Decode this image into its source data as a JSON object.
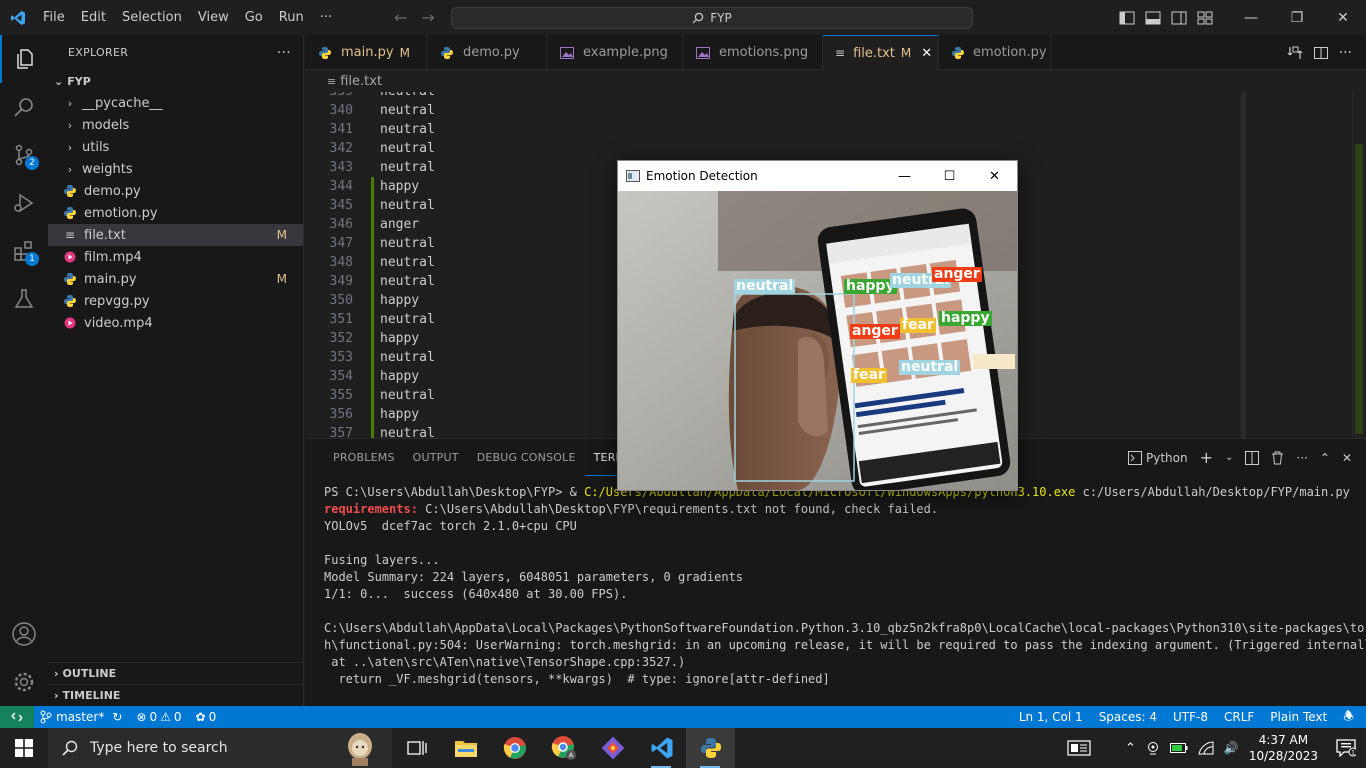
{
  "titlebar": {
    "menu": [
      "File",
      "Edit",
      "Selection",
      "View",
      "Go",
      "Run",
      "···"
    ],
    "search_text": "FYP"
  },
  "activity": {
    "source_control_badge": "2",
    "extensions_badge": "1"
  },
  "explorer": {
    "title": "EXPLORER",
    "more": "···",
    "folder": "FYP",
    "items": [
      {
        "label": "__pycache__",
        "type": "folder",
        "mark": ""
      },
      {
        "label": "models",
        "type": "folder",
        "mark": ""
      },
      {
        "label": "utils",
        "type": "folder",
        "mark": ""
      },
      {
        "label": "weights",
        "type": "folder",
        "mark": ""
      },
      {
        "label": "demo.py",
        "type": "py",
        "mark": ""
      },
      {
        "label": "emotion.py",
        "type": "py",
        "mark": ""
      },
      {
        "label": "file.txt",
        "type": "txt",
        "mark": "M"
      },
      {
        "label": "film.mp4",
        "type": "mp4",
        "mark": ""
      },
      {
        "label": "main.py",
        "type": "py",
        "mark": "M"
      },
      {
        "label": "repvgg.py",
        "type": "py",
        "mark": ""
      },
      {
        "label": "video.mp4",
        "type": "mp4",
        "mark": ""
      }
    ],
    "outline": "OUTLINE",
    "timeline": "TIMELINE"
  },
  "tabs": [
    {
      "label": "main.py",
      "type": "py",
      "mark": "M",
      "active": false
    },
    {
      "label": "demo.py",
      "type": "py",
      "mark": "",
      "active": false
    },
    {
      "label": "example.png",
      "type": "png",
      "mark": "",
      "active": false
    },
    {
      "label": "emotions.png",
      "type": "png",
      "mark": "",
      "active": false
    },
    {
      "label": "file.txt",
      "type": "txt",
      "mark": "M",
      "active": true
    },
    {
      "label": "emotion.py",
      "type": "py",
      "mark": "",
      "active": false
    }
  ],
  "breadcrumb": "file.txt",
  "editor": {
    "lines": [
      {
        "n": "339",
        "t": "neutral",
        "mod": false
      },
      {
        "n": "340",
        "t": "neutral",
        "mod": false
      },
      {
        "n": "341",
        "t": "neutral",
        "mod": false
      },
      {
        "n": "342",
        "t": "neutral",
        "mod": false
      },
      {
        "n": "343",
        "t": "neutral",
        "mod": false
      },
      {
        "n": "344",
        "t": "happy",
        "mod": true
      },
      {
        "n": "345",
        "t": "neutral",
        "mod": true
      },
      {
        "n": "346",
        "t": "anger",
        "mod": true
      },
      {
        "n": "347",
        "t": "neutral",
        "mod": true
      },
      {
        "n": "348",
        "t": "neutral",
        "mod": true
      },
      {
        "n": "349",
        "t": "neutral",
        "mod": true
      },
      {
        "n": "350",
        "t": "happy",
        "mod": true
      },
      {
        "n": "351",
        "t": "neutral",
        "mod": true
      },
      {
        "n": "352",
        "t": "happy",
        "mod": true
      },
      {
        "n": "353",
        "t": "neutral",
        "mod": true
      },
      {
        "n": "354",
        "t": "happy",
        "mod": true
      },
      {
        "n": "355",
        "t": "neutral",
        "mod": true
      },
      {
        "n": "356",
        "t": "happy",
        "mod": true
      },
      {
        "n": "357",
        "t": "neutral",
        "mod": true
      }
    ]
  },
  "panel": {
    "tabs": [
      "PROBLEMS",
      "OUTPUT",
      "DEBUG CONSOLE",
      "TERMINAL"
    ],
    "shell": "Python",
    "terminal": {
      "prompt": "PS C:\\Users\\Abdullah\\Desktop\\FYP> & ",
      "exe": "C:/Users/Abdullah/AppData/Local/Microsoft/WindowsApps/python3.10.exe",
      "arg": " c:/Users/Abdullah/Desktop/FYP/main.py",
      "req_label": "requirements:",
      "req_text": " C:\\Users\\Abdullah\\Desktop\\FYP\\requirements.txt not found, check failed.",
      "l3": "YOLOv5  dcef7ac torch 2.1.0+cpu CPU",
      "l5": "Fusing layers...",
      "l6": "Model Summary: 224 layers, 6048051 parameters, 0 gradients",
      "l7": "1/1: 0...  success (640x480 at 30.00 FPS).",
      "l9": "C:\\Users\\Abdullah\\AppData\\Local\\Packages\\PythonSoftwareFoundation.Python.3.10_qbz5n2kfra8p0\\LocalCache\\local-packages\\Python310\\site-packages\\torc",
      "l10": "h\\functional.py:504: UserWarning: torch.meshgrid: in an upcoming release, it will be required to pass the indexing argument. (Triggered internally",
      "l11": " at ..\\aten\\src\\ATen\\native\\TensorShape.cpp:3527.)",
      "l12": "  return _VF.meshgrid(tensors, **kwargs)  # type: ignore[attr-defined]"
    }
  },
  "emotion_window": {
    "title": "Emotion Detection",
    "labels": [
      {
        "text": "neutral",
        "color": "#9fd4e0"
      },
      {
        "text": "happy",
        "color": "#38a832"
      },
      {
        "text": "neutral",
        "color": "#9fd4e0"
      },
      {
        "text": "anger",
        "color": "#f03c14"
      },
      {
        "text": "anger",
        "color": "#f03c14"
      },
      {
        "text": "fear",
        "color": "#f0c030"
      },
      {
        "text": "happy",
        "color": "#38a832"
      },
      {
        "text": "fear",
        "color": "#f0c030"
      },
      {
        "text": "neutral",
        "color": "#9fd4e0"
      }
    ]
  },
  "statusbar": {
    "branch": "master*",
    "errors": "0",
    "warnings": "0",
    "ports": "0",
    "position": "Ln 1, Col 1",
    "spaces": "Spaces: 4",
    "encoding": "UTF-8",
    "eol": "CRLF",
    "language": "Plain Text"
  },
  "taskbar": {
    "search_placeholder": "Type here to search",
    "time": "4:37 AM",
    "date": "10/28/2023"
  }
}
